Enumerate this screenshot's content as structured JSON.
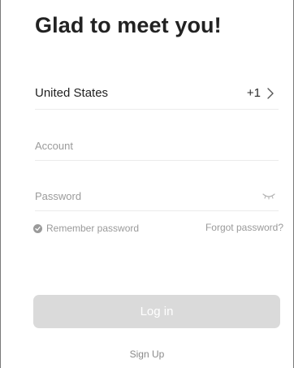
{
  "header": {
    "title": "Glad to meet you!"
  },
  "country": {
    "label": "United States",
    "code": "+1",
    "chevron_icon": "chevron-right-icon"
  },
  "account": {
    "placeholder": "Account",
    "value": ""
  },
  "password": {
    "placeholder": "Password",
    "value": "",
    "toggle_icon": "eye-closed-icon"
  },
  "remember": {
    "label": "Remember password",
    "checked": true,
    "icon": "check-circle-icon"
  },
  "forgot": {
    "label": "Forgot password?"
  },
  "login": {
    "label": "Log in",
    "enabled": false
  },
  "signup": {
    "label": "Sign Up"
  },
  "colors": {
    "title_text": "#222222",
    "muted_text": "#9a9a9a",
    "divider": "#ebebeb",
    "button_disabled_bg": "#dadada",
    "button_text": "#ffffff"
  }
}
